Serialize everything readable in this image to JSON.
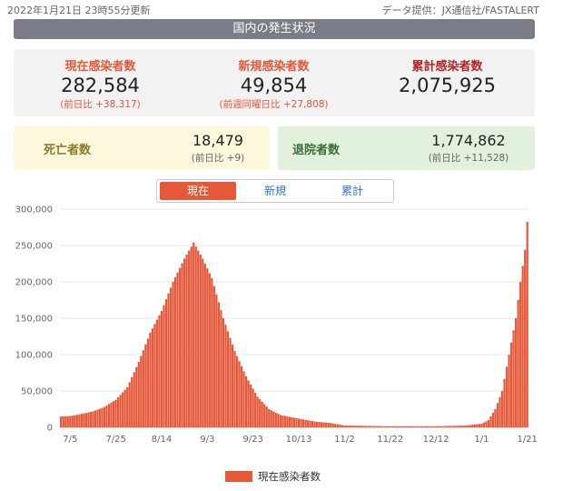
{
  "header": {
    "updated": "2022年1月21日 23時55分更新",
    "source": "データ提供：JX通信社/FASTALERT"
  },
  "banner_title": "国内の発生状況",
  "stats": {
    "current": {
      "label": "現在感染者数",
      "value": "282,584",
      "diff": "(前日比 +38,317)"
    },
    "new": {
      "label": "新規感染者数",
      "value": "49,854",
      "diff": "(前週同曜日比 +27,808)"
    },
    "cumulative": {
      "label": "累計感染者数",
      "value": "2,075,925"
    },
    "deaths": {
      "label": "死亡者数",
      "value": "18,479",
      "diff": "(前日比 +9)"
    },
    "recovered": {
      "label": "退院者数",
      "value": "1,774,862",
      "diff": "(前日比 +11,528)"
    }
  },
  "tabs": [
    {
      "label": "現在",
      "active": true
    },
    {
      "label": "新規",
      "active": false
    },
    {
      "label": "累計",
      "active": false
    }
  ],
  "colors": {
    "bar": "#e5583a",
    "accent_orange": "#e5583a",
    "accent_red": "#b42323"
  },
  "chart_data": {
    "type": "bar",
    "series": [
      {
        "name": "現在感染者数"
      }
    ],
    "x_ticks": [
      "7/5",
      "7/25",
      "8/14",
      "9/3",
      "9/23",
      "10/13",
      "11/2",
      "11/22",
      "12/12",
      "1/1",
      "1/21"
    ],
    "ylim": [
      0,
      300000
    ],
    "y_ticks": [
      "0",
      "50,000",
      "100,000",
      "150,000",
      "200,000",
      "250,000",
      "300,000"
    ],
    "grid": true,
    "legend_position": "bottom",
    "anchors": [
      [
        "2021-07-01",
        15000
      ],
      [
        "2021-07-05",
        15500
      ],
      [
        "2021-07-10",
        18500
      ],
      [
        "2021-07-15",
        22000
      ],
      [
        "2021-07-20",
        28000
      ],
      [
        "2021-07-25",
        38000
      ],
      [
        "2021-07-30",
        55000
      ],
      [
        "2021-08-04",
        90000
      ],
      [
        "2021-08-09",
        130000
      ],
      [
        "2021-08-14",
        160000
      ],
      [
        "2021-08-19",
        200000
      ],
      [
        "2021-08-24",
        232000
      ],
      [
        "2021-08-28",
        254000
      ],
      [
        "2021-09-01",
        232000
      ],
      [
        "2021-09-05",
        205000
      ],
      [
        "2021-09-10",
        150000
      ],
      [
        "2021-09-15",
        105000
      ],
      [
        "2021-09-20",
        70000
      ],
      [
        "2021-09-25",
        42000
      ],
      [
        "2021-09-30",
        25000
      ],
      [
        "2021-10-05",
        17000
      ],
      [
        "2021-10-13",
        12000
      ],
      [
        "2021-10-20",
        8000
      ],
      [
        "2021-10-27",
        6000
      ],
      [
        "2021-11-02",
        2500
      ],
      [
        "2021-11-22",
        1500
      ],
      [
        "2021-12-12",
        1500
      ],
      [
        "2021-12-25",
        2500
      ],
      [
        "2022-01-01",
        5000
      ],
      [
        "2022-01-04",
        10000
      ],
      [
        "2022-01-07",
        25000
      ],
      [
        "2022-01-10",
        50000
      ],
      [
        "2022-01-13",
        100000
      ],
      [
        "2022-01-16",
        150000
      ],
      [
        "2022-01-18",
        200000
      ],
      [
        "2022-01-20",
        244000
      ],
      [
        "2022-01-21",
        282584
      ]
    ]
  }
}
